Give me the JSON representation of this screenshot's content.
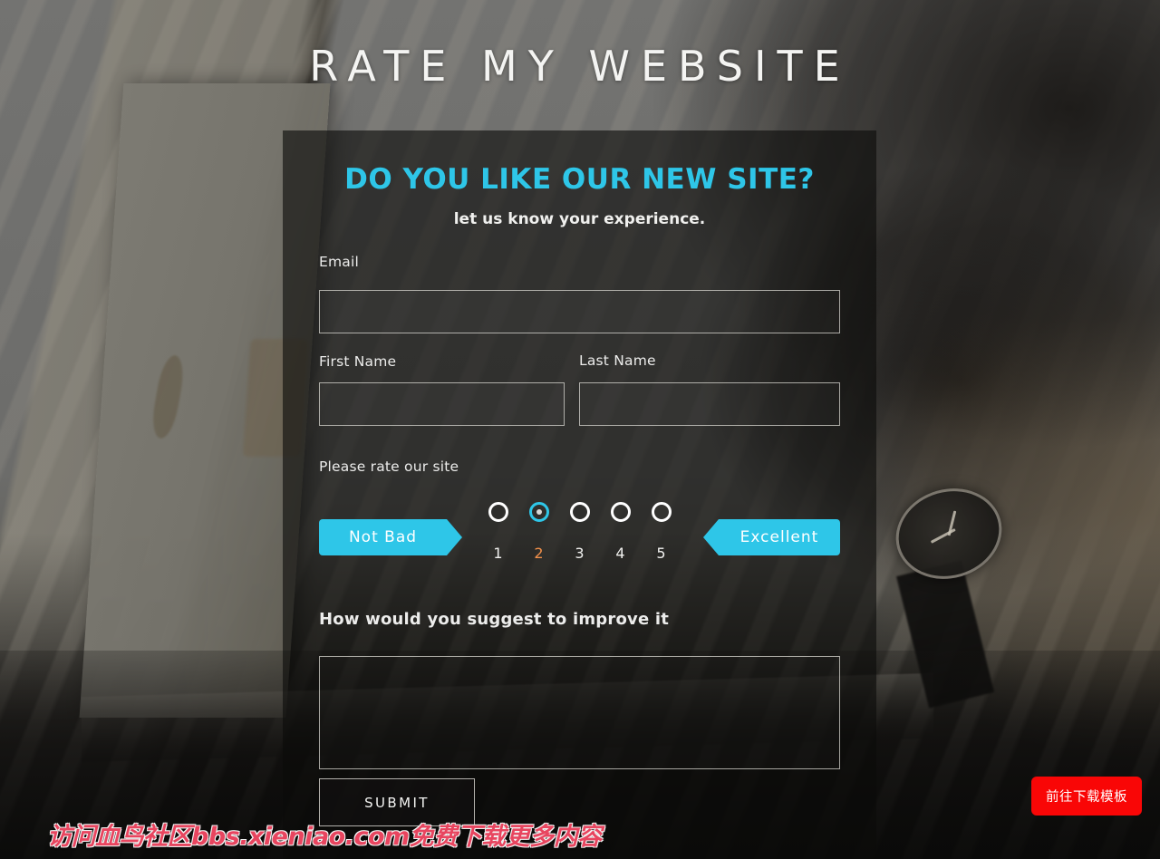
{
  "page": {
    "title": "RATE MY WEBSITE",
    "background_description": "hands-typing-on-laptop-photo"
  },
  "form": {
    "heading": "DO YOU LIKE OUR NEW SITE?",
    "subheading": "let us know your experience.",
    "accent_color": "#2ec6e8",
    "fields": {
      "email": {
        "label": "Email",
        "value": "",
        "placeholder": ""
      },
      "first_name": {
        "label": "First Name",
        "value": "",
        "placeholder": ""
      },
      "last_name": {
        "label": "Last Name",
        "value": "",
        "placeholder": ""
      },
      "improve": {
        "label": "How would you suggest to improve it",
        "value": "",
        "placeholder": ""
      }
    },
    "rating": {
      "label": "Please rate our site",
      "low_badge": "Not Bad",
      "high_badge": "Excellent",
      "selected": "2",
      "selected_color": "#f2904a",
      "options": [
        {
          "number": "1"
        },
        {
          "number": "2"
        },
        {
          "number": "3"
        },
        {
          "number": "4"
        },
        {
          "number": "5"
        }
      ]
    },
    "submit_label": "SUBMIT"
  },
  "overlay": {
    "watermark": "访问血鸟社区bbs.xieniao.com免费下载更多内容",
    "watermark_color": "#e8455f",
    "download_button": "前往下载模板",
    "download_button_color": "#f90606"
  }
}
